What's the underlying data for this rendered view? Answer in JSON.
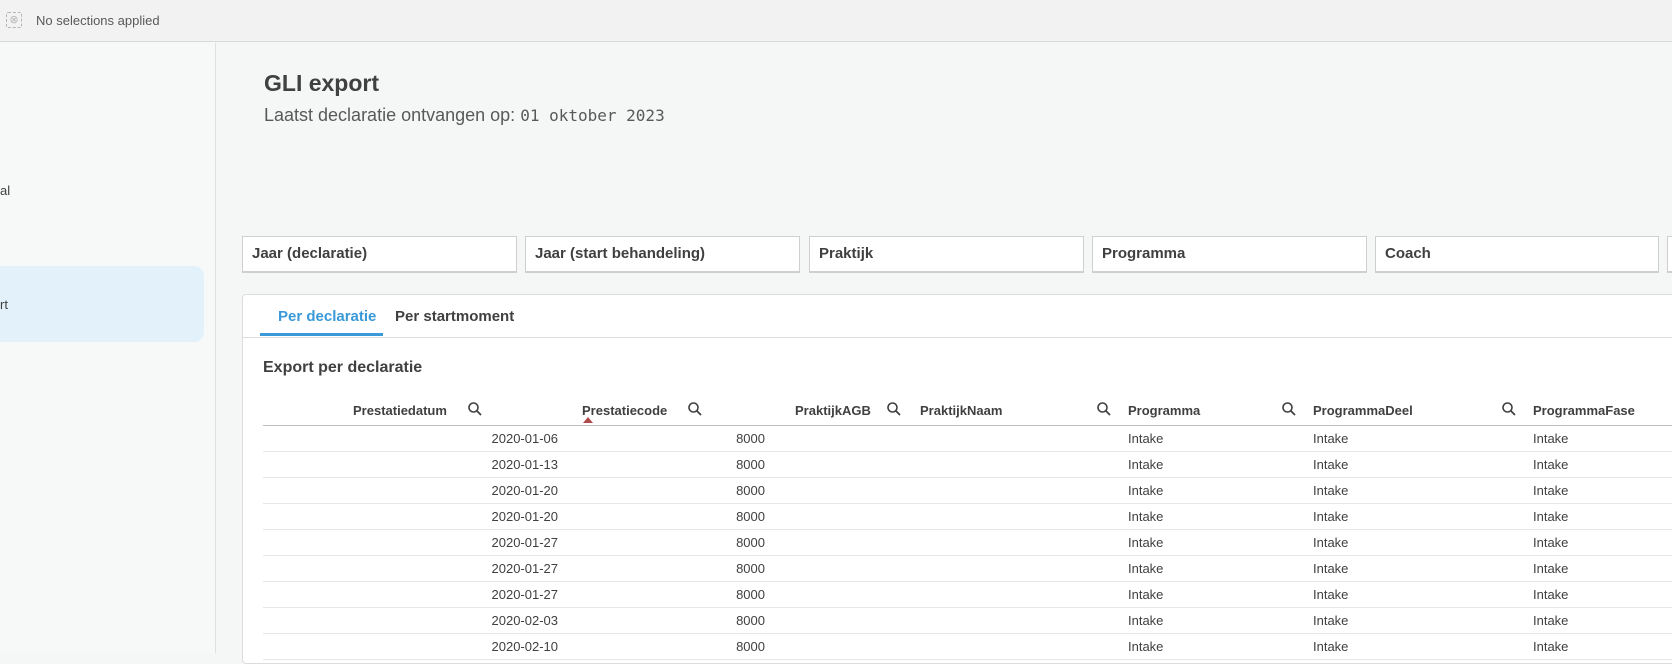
{
  "topbar": {
    "selections_text": "No selections applied",
    "icon": "selections-icon"
  },
  "sidebar": {
    "items": [
      {
        "label": "al"
      },
      {
        "label": "rt"
      }
    ]
  },
  "page": {
    "title": "GLI export",
    "subtitle_prefix": "Laatst declaratie ontvangen op:",
    "subtitle_date": "01 oktober 2023"
  },
  "filters": [
    {
      "label": "Jaar (declaratie)"
    },
    {
      "label": "Jaar (start behandeling)"
    },
    {
      "label": "Praktijk"
    },
    {
      "label": "Programma"
    },
    {
      "label": "Coach"
    }
  ],
  "tabs": [
    {
      "label": "Per declaratie",
      "active": true
    },
    {
      "label": "Per startmoment",
      "active": false
    }
  ],
  "section_title": "Export per declaratie",
  "table": {
    "columns": [
      "Prestatiedatum",
      "Prestatiecode",
      "PraktijkAGB",
      "PraktijkNaam",
      "Programma",
      "ProgrammaDeel",
      "ProgrammaFase"
    ],
    "rows": [
      [
        "2020-01-06",
        "8000",
        "",
        "",
        "Intake",
        "Intake",
        "Intake"
      ],
      [
        "2020-01-13",
        "8000",
        "",
        "",
        "Intake",
        "Intake",
        "Intake"
      ],
      [
        "2020-01-20",
        "8000",
        "",
        "",
        "Intake",
        "Intake",
        "Intake"
      ],
      [
        "2020-01-20",
        "8000",
        "",
        "",
        "Intake",
        "Intake",
        "Intake"
      ],
      [
        "2020-01-27",
        "8000",
        "",
        "",
        "Intake",
        "Intake",
        "Intake"
      ],
      [
        "2020-01-27",
        "8000",
        "",
        "",
        "Intake",
        "Intake",
        "Intake"
      ],
      [
        "2020-01-27",
        "8000",
        "",
        "",
        "Intake",
        "Intake",
        "Intake"
      ],
      [
        "2020-02-03",
        "8000",
        "",
        "",
        "Intake",
        "Intake",
        "Intake"
      ],
      [
        "2020-02-10",
        "8000",
        "",
        "",
        "Intake",
        "Intake",
        "Intake"
      ]
    ]
  },
  "colors": {
    "accent": "#3a99d8",
    "sidebar_active": "#e3f2fa",
    "sort_marker": "#b04a4a"
  }
}
